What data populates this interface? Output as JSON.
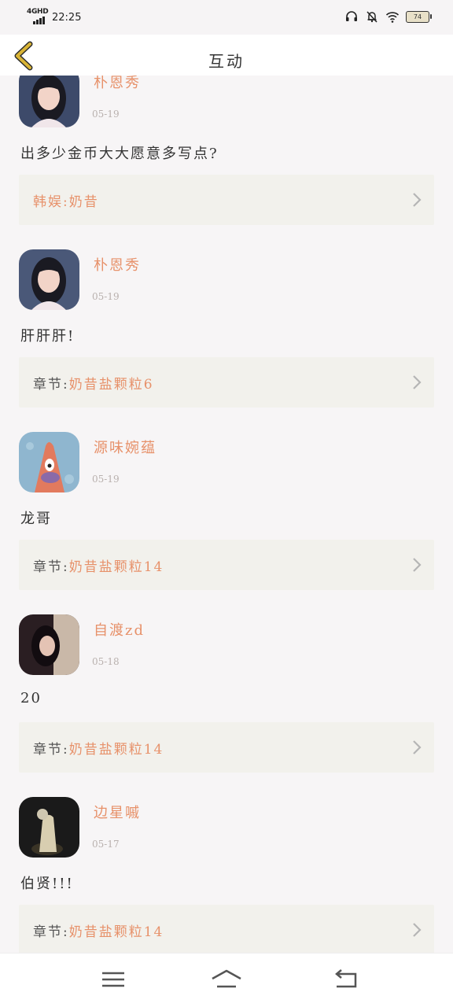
{
  "status_bar": {
    "network": "4GHD",
    "time": "22:25",
    "battery": "74"
  },
  "header": {
    "title": "互动"
  },
  "comments": [
    {
      "username": "朴恩秀",
      "date": "05-19",
      "text": "出多少金币大大愿意多写点?",
      "ref_prefix": "",
      "ref_value": "韩娱:奶昔"
    },
    {
      "username": "朴恩秀",
      "date": "05-19",
      "text": "肝肝肝!",
      "ref_prefix": "章节:",
      "ref_value": "奶昔盐颗粒6"
    },
    {
      "username": "源味婉蕴",
      "date": "05-19",
      "text": "龙哥",
      "ref_prefix": "章节:",
      "ref_value": "奶昔盐颗粒14"
    },
    {
      "username": "自渡zd",
      "date": "05-18",
      "text": "20",
      "ref_prefix": "章节:",
      "ref_value": "奶昔盐颗粒14"
    },
    {
      "username": "边星嘁",
      "date": "05-17",
      "text": "伯贤!!!",
      "ref_prefix": "章节:",
      "ref_value": "奶昔盐颗粒14"
    }
  ],
  "colors": {
    "accent": "#e7916a",
    "back_arrow": "#c9a62a"
  }
}
